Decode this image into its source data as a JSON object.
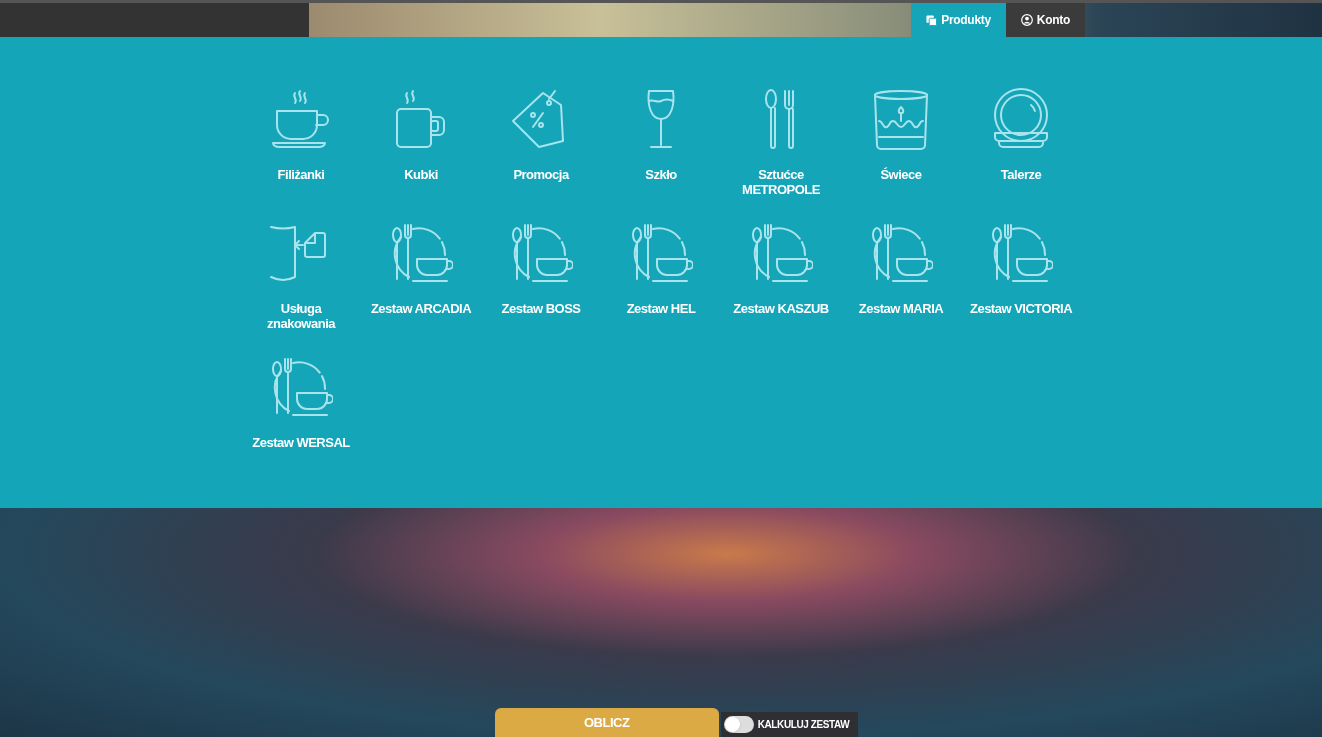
{
  "nav": {
    "tabs": [
      {
        "label": "Produkty",
        "kind": "products",
        "selected": true
      },
      {
        "label": "Konto",
        "kind": "account",
        "selected": false
      }
    ]
  },
  "categories": [
    {
      "label": "Filiżanki",
      "kind": "cup"
    },
    {
      "label": "Kubki",
      "kind": "mug"
    },
    {
      "label": "Promocja",
      "kind": "tag"
    },
    {
      "label": "Szkło",
      "kind": "glass"
    },
    {
      "label": "Sztućce METROPOLE",
      "kind": "cutlery"
    },
    {
      "label": "Świece",
      "kind": "candle"
    },
    {
      "label": "Talerze",
      "kind": "plate"
    },
    {
      "label": "Usługa znakowania",
      "kind": "marking"
    },
    {
      "label": "Zestaw ARCADIA",
      "kind": "set"
    },
    {
      "label": "Zestaw BOSS",
      "kind": "set"
    },
    {
      "label": "Zestaw HEL",
      "kind": "set"
    },
    {
      "label": "Zestaw KASZUB",
      "kind": "set"
    },
    {
      "label": "Zestaw MARIA",
      "kind": "set"
    },
    {
      "label": "Zestaw VICTORIA",
      "kind": "set"
    },
    {
      "label": "Zestaw WERSAL",
      "kind": "set"
    }
  ],
  "footer": {
    "calculate_button": "OBLICZ",
    "set_toggle": {
      "label": "KALKULUJ ZESTAW",
      "on": false
    }
  }
}
